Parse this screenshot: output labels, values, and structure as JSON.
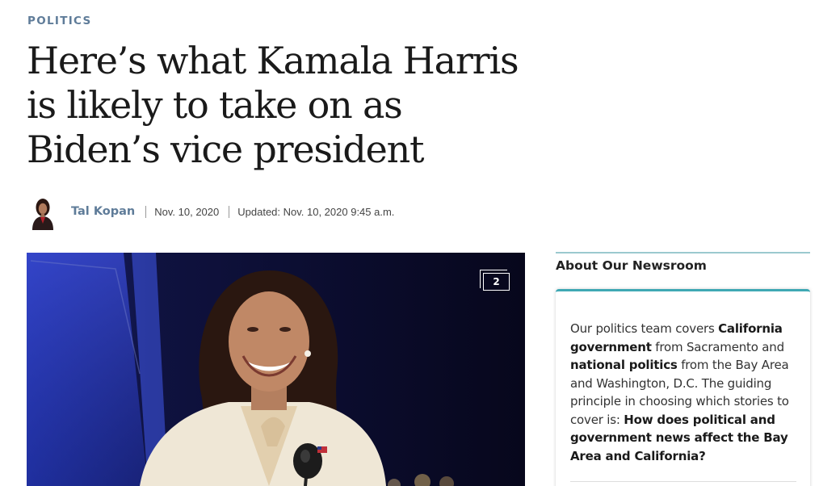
{
  "article": {
    "section": "POLITICS",
    "headline": "Here’s what Kamala Harris is likely to take on as Biden’s vice president",
    "byline": {
      "author": "Tal Kopan",
      "date": "Nov. 10, 2020",
      "updated": "Updated: Nov. 10, 2020 9:45 a.m."
    },
    "photo": {
      "gallery_count": "2"
    }
  },
  "sidebar": {
    "title": "About Our Newsroom",
    "text_parts": [
      "Our politics team covers ",
      "California government",
      " from Sacramento and ",
      "national politics",
      " from the Bay Area and Washington, D.C. The guiding principle in choosing which stories to cover is: ",
      "How does political and government news affect the Bay Area and California?"
    ]
  },
  "colors": {
    "accent": "#5f7c99",
    "teal": "#3fa8b4",
    "photo_background": "#0b0b2a"
  }
}
